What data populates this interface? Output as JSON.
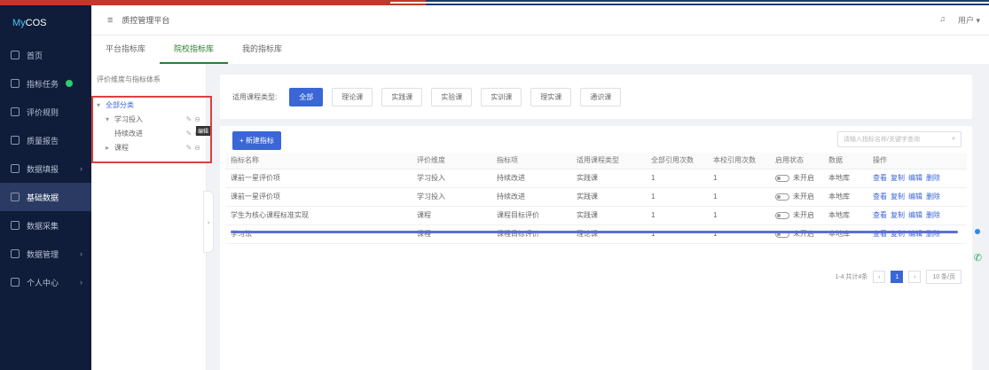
{
  "app": {
    "logo_prefix": "My",
    "logo_suffix": "COS"
  },
  "sidebar": {
    "items": [
      {
        "label": "首页"
      },
      {
        "label": "指标任务"
      },
      {
        "label": "评价规则"
      },
      {
        "label": "质量报告"
      },
      {
        "label": "数据填报"
      },
      {
        "label": "基础数据"
      },
      {
        "label": "数据采集"
      },
      {
        "label": "数据管理"
      },
      {
        "label": "个人中心"
      }
    ]
  },
  "header": {
    "menu_icon": "≡",
    "title": "质控管理平台",
    "right_icons": [
      "bell-icon",
      "user-icon"
    ],
    "user_label": "用户"
  },
  "tabs": [
    {
      "label": "平台指标库"
    },
    {
      "label": "院校指标库"
    },
    {
      "label": "我的指标库"
    }
  ],
  "left_panel": {
    "title": "评价维度与指标体系",
    "tree": [
      {
        "label": "全部分类"
      },
      {
        "label": "学习投入"
      },
      {
        "label": "持续改进"
      },
      {
        "label": "课程"
      }
    ],
    "tooltip": "编辑"
  },
  "filter": {
    "label": "适用课程类型:",
    "chips": [
      "全部",
      "理论课",
      "实践课",
      "实验课",
      "实训课",
      "理实课",
      "通识课"
    ]
  },
  "table": {
    "add_button": "+ 新建指标",
    "search_placeholder": "请输入指标名称/关键字查询",
    "columns": [
      "指标名称",
      "评价维度",
      "指标项",
      "适用课程类型",
      "全部引用次数",
      "本校引用次数",
      "启用状态",
      "数据",
      "操作"
    ],
    "rows": [
      {
        "name": "课前一星评价项",
        "dim": "学习投入",
        "item": "持续改进",
        "course_type": "实践课",
        "total": "1",
        "local": "1",
        "status": "未开启",
        "data": "本地库"
      },
      {
        "name": "课前一星评价项",
        "dim": "学习投入",
        "item": "持续改进",
        "course_type": "实践课",
        "total": "1",
        "local": "1",
        "status": "未开启",
        "data": "本地库"
      },
      {
        "name": "学生为核心课程标准实现",
        "dim": "课程",
        "item": "课程目标评价",
        "course_type": "实践课",
        "total": "1",
        "local": "1",
        "status": "未开启",
        "data": "本地库"
      },
      {
        "name": "学习法",
        "dim": "课程",
        "item": "课程目标评价",
        "course_type": "理论课",
        "total": "1",
        "local": "1",
        "status": "未开启",
        "data": "本地库"
      }
    ],
    "ops": [
      "查看",
      "复制",
      "编辑",
      "删除"
    ]
  },
  "pagination": {
    "summary": "1-4 共计4条",
    "prev": "‹",
    "current": "1",
    "next": "›",
    "page_size": "10 条/页"
  },
  "colors": {
    "sidebar_bg": "#0f1d3a",
    "accent_blue": "#3a66d6",
    "tab_active_green": "#2e7d32",
    "highlight_red": "#d94141"
  }
}
